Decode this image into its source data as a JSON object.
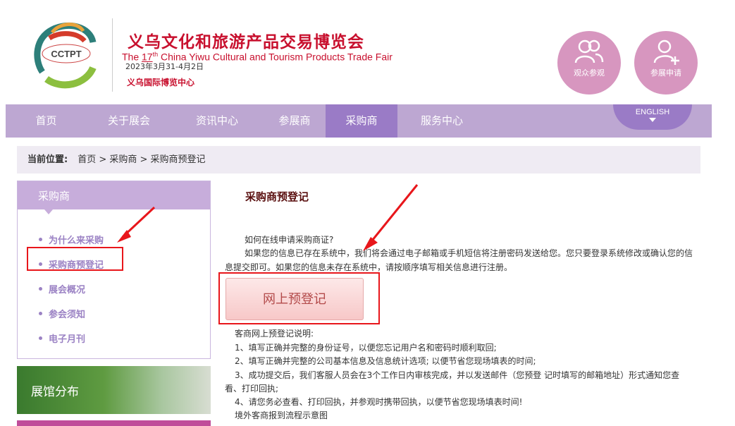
{
  "header": {
    "logo_text": "CCTPT",
    "title_cn": "义乌文化和旅游产品交易博览会",
    "title_en_pre": "The ",
    "title_en_num": "17",
    "title_en_sup": "th",
    "title_en_post": " China Yiwu Cultural and Tourism Products Trade Fair",
    "date": "2023年3月31-4月2日",
    "venue": "义乌国际博览中心",
    "circle_visit": "观众参观",
    "circle_exhibit": "参展申请"
  },
  "nav": {
    "items": [
      "首页",
      "关于展会",
      "资讯中心",
      "参展商",
      "采购商",
      "服务中心"
    ],
    "active_index": 4,
    "english": "ENGLISH"
  },
  "breadcrumb": {
    "label": "当前位置:",
    "path": "首页 > 采购商 > 采购商预登记"
  },
  "sidebar": {
    "heading": "采购商",
    "items": [
      "为什么来采购",
      "采购商预登记",
      "展会概况",
      "参会须知",
      "电子月刊"
    ],
    "banner1": "展馆分布"
  },
  "main": {
    "title": "采购商预登记",
    "p1": "如何在线申请采购商证?",
    "p2a": "如果您的信息已存在系统中，我们将会通过电子邮箱或手机短信将注册密码发送给您。您只要登录系统修改或确认您的信",
    "p2b": "息提交即可。如果您的信息未存在系统中，请按顺序填写相关信息进行注册。",
    "button": "网上预登记",
    "notes_title": "客商网上预登记说明:",
    "n1": "1、填写正确并完整的身份证号，以便您忘记用户名和密码时顺利取回;",
    "n2": "2、填写正确并完整的公司基本信息及信息统计选项; 以便节省您现场填表的时间;",
    "n3a": "3、成功提交后，我们客服人员会在3个工作日内审核完成，并以发送邮件（您预登 记时填写的邮箱地址）形式通知您查",
    "n3b": "看、打印回执;",
    "n4": "4、请您务必查看、打印回执，并参观时携带回执，以便节省您现场填表时间!",
    "n5": "境外客商报到流程示意图"
  },
  "colors": {
    "brand_red": "#c8102e",
    "nav_bg": "#bda7d2",
    "nav_active": "#9a7bc6",
    "annotation_red": "#e8161b"
  }
}
